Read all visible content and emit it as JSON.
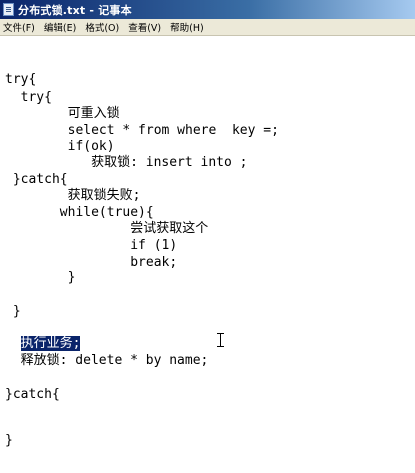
{
  "window": {
    "title": "分布式锁.txt - 记事本",
    "icon": "notepad-icon"
  },
  "menu": {
    "items": [
      "文件(F)",
      "编辑(E)",
      "格式(O)",
      "查看(V)",
      "帮助(H)"
    ]
  },
  "editor": {
    "lines": [
      "try{",
      "  try{",
      "        可重入锁",
      "        select * from where  key =;",
      "        if(ok)",
      "           获取锁: insert into ;",
      " }catch{",
      "        获取锁失败;",
      "       while(true){",
      "                尝试获取这个",
      "                if (1)",
      "                break;",
      "        }",
      " }",
      "  执行业务;",
      "  释放锁: delete * by name;",
      "}catch{",
      "}"
    ],
    "selected_text": "执行业务;"
  }
}
